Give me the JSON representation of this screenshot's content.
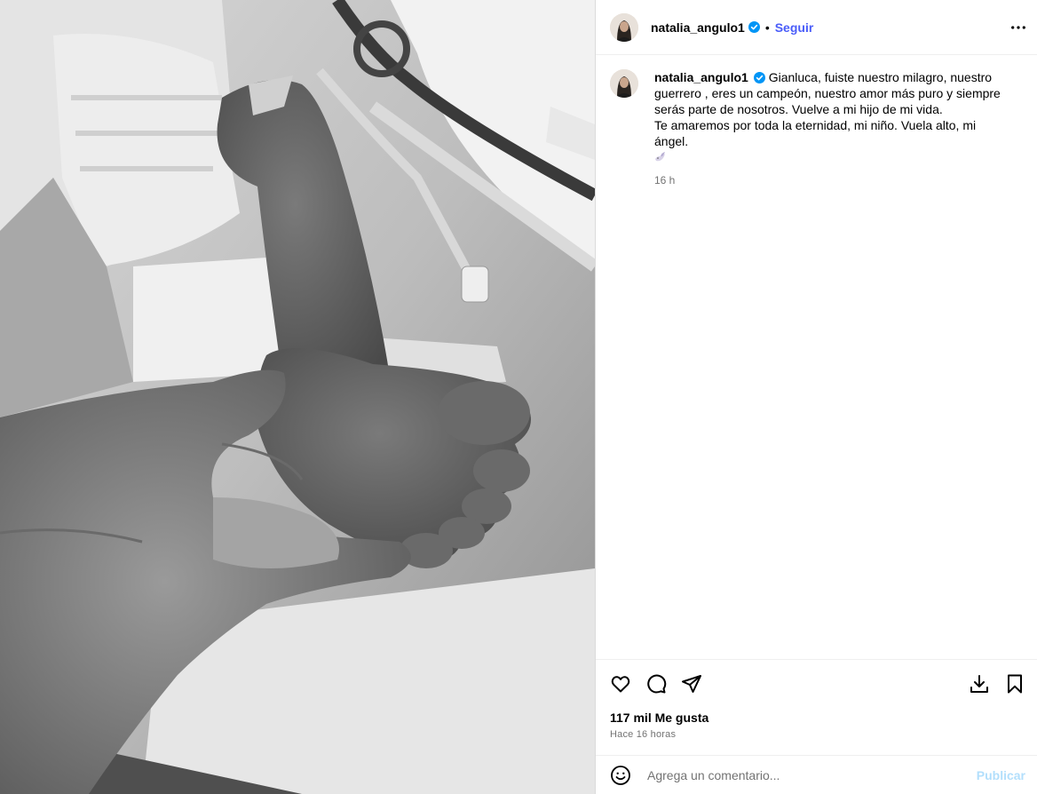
{
  "post": {
    "username": "natalia_angulo1",
    "verified": true,
    "separator": "•",
    "follow_label": "Seguir",
    "more_icon": "more-horizontal-icon"
  },
  "caption": {
    "username": "natalia_angulo1",
    "lines": [
      "Gianluca, fuiste nuestro milagro, nuestro guerrero , eres un campeón, nuestro amor más puro y siempre serás parte de nosotros. Vuelve a mi hijo de mi vida.",
      "Te amaremos por toda la eternidad, mi niño. Vuela alto, mi ángel."
    ],
    "emoji": "dove-icon",
    "time": "16 h"
  },
  "actions": {
    "like_icon": "heart-icon",
    "comment_icon": "comment-icon",
    "share_icon": "share-icon",
    "download_icon": "download-icon",
    "save_icon": "bookmark-icon"
  },
  "stats": {
    "likes": "117 mil Me gusta",
    "posted": "Hace 16 horas"
  },
  "comment": {
    "placeholder": "Agrega un comentario...",
    "publish_label": "Publicar"
  },
  "colors": {
    "accent": "#4a5df9",
    "publish_disabled": "#b2dffc",
    "secondary_text": "#737373",
    "verified": "#0095f6",
    "divider": "#efefef"
  }
}
